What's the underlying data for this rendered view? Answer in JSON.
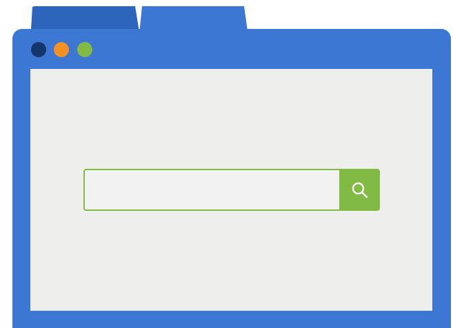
{
  "colors": {
    "background": "#ffffff",
    "frame": "#3c77d4",
    "tab_inactive": "#2d65bd",
    "tab_active": "#3c77d4",
    "viewport": "#eeeeed",
    "search_field": "#f2f2f2",
    "search_border": "#82bb44",
    "search_button": "#82bb44",
    "search_icon": "#ffffff"
  },
  "window_controls": [
    {
      "name": "close-dot",
      "color": "#15366b"
    },
    {
      "name": "minimize-dot",
      "color": "#f39026"
    },
    {
      "name": "maximize-dot",
      "color": "#82bb44"
    }
  ],
  "search": {
    "value": "",
    "placeholder": "",
    "icon": "search-icon"
  }
}
